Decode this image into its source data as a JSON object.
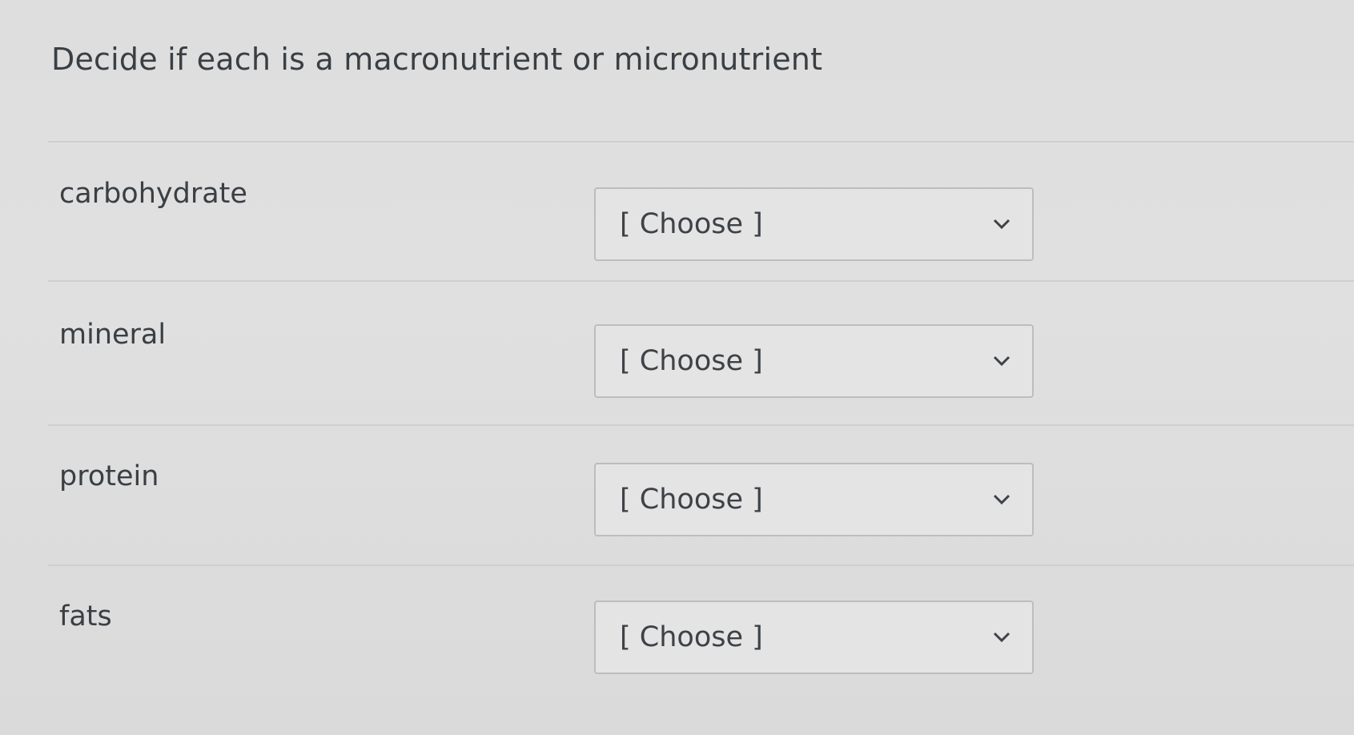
{
  "question": {
    "text": "Decide if each is a macronutrient or micronutrient"
  },
  "rows": [
    {
      "label": "carbohydrate",
      "select_value": "[ Choose ]"
    },
    {
      "label": "mineral",
      "select_value": "[ Choose ]"
    },
    {
      "label": "protein",
      "select_value": "[ Choose ]"
    },
    {
      "label": "fats",
      "select_value": "[ Choose ]"
    }
  ],
  "icons": {
    "dropdown": "chevron-down-icon"
  }
}
